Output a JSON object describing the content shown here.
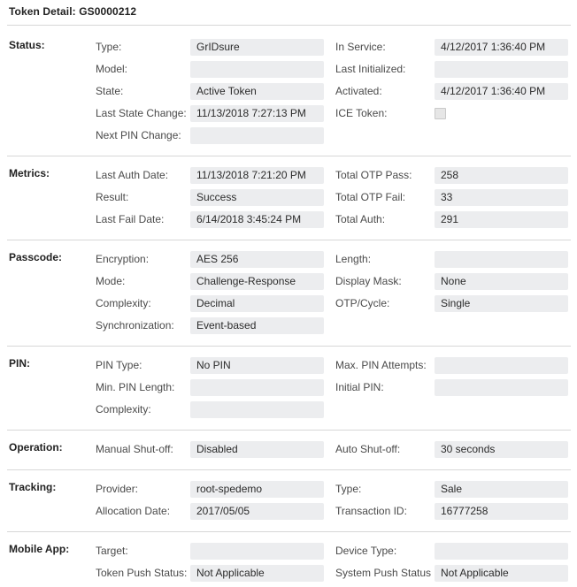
{
  "header": {
    "title": "Token Detail: GS0000212"
  },
  "colors": {
    "value_field_bg": "#ecedef",
    "divider": "#d7d7d7",
    "label_text": "#4a4a4a",
    "section_text": "#222222"
  },
  "sections": [
    {
      "name": "status",
      "label": "Status:",
      "rows": [
        {
          "left": {
            "label": "Type:",
            "value": "GrIDsure"
          },
          "right": {
            "label": "In Service:",
            "value": "4/12/2017 1:36:40 PM"
          }
        },
        {
          "left": {
            "label": "Model:",
            "value": ""
          },
          "right": {
            "label": "Last Initialized:",
            "value": ""
          }
        },
        {
          "left": {
            "label": "State:",
            "value": "Active Token"
          },
          "right": {
            "label": "Activated:",
            "value": "4/12/2017 1:36:40 PM"
          }
        },
        {
          "left": {
            "label": "Last State Change:",
            "value": "11/13/2018 7:27:13 PM"
          },
          "right": {
            "label": "ICE Token:",
            "value": "",
            "type": "checkbox",
            "checked": false
          }
        },
        {
          "left": {
            "label": "Next PIN Change:",
            "value": ""
          },
          "right": null
        }
      ]
    },
    {
      "name": "metrics",
      "label": "Metrics:",
      "rows": [
        {
          "left": {
            "label": "Last Auth Date:",
            "value": "11/13/2018 7:21:20 PM"
          },
          "right": {
            "label": "Total OTP Pass:",
            "value": "258"
          }
        },
        {
          "left": {
            "label": "Result:",
            "value": "Success"
          },
          "right": {
            "label": "Total OTP Fail:",
            "value": "33"
          }
        },
        {
          "left": {
            "label": "Last Fail Date:",
            "value": "6/14/2018 3:45:24 PM"
          },
          "right": {
            "label": "Total Auth:",
            "value": "291"
          }
        }
      ]
    },
    {
      "name": "passcode",
      "label": "Passcode:",
      "rows": [
        {
          "left": {
            "label": "Encryption:",
            "value": "AES 256"
          },
          "right": {
            "label": "Length:",
            "value": ""
          }
        },
        {
          "left": {
            "label": "Mode:",
            "value": "Challenge-Response"
          },
          "right": {
            "label": "Display Mask:",
            "value": "None"
          }
        },
        {
          "left": {
            "label": "Complexity:",
            "value": "Decimal"
          },
          "right": {
            "label": "OTP/Cycle:",
            "value": "Single"
          }
        },
        {
          "left": {
            "label": "Synchronization:",
            "value": "Event-based"
          },
          "right": null
        }
      ]
    },
    {
      "name": "pin",
      "label": "PIN:",
      "rows": [
        {
          "left": {
            "label": "PIN Type:",
            "value": "No PIN"
          },
          "right": {
            "label": "Max. PIN Attempts:",
            "value": ""
          }
        },
        {
          "left": {
            "label": "Min. PIN Length:",
            "value": ""
          },
          "right": {
            "label": "Initial PIN:",
            "value": ""
          }
        },
        {
          "left": {
            "label": "Complexity:",
            "value": ""
          },
          "right": null
        }
      ]
    },
    {
      "name": "operation",
      "label": "Operation:",
      "rows": [
        {
          "left": {
            "label": "Manual Shut-off:",
            "value": "Disabled"
          },
          "right": {
            "label": "Auto Shut-off:",
            "value": "30 seconds"
          }
        }
      ]
    },
    {
      "name": "tracking",
      "label": "Tracking:",
      "rows": [
        {
          "left": {
            "label": "Provider:",
            "value": "root-spedemo"
          },
          "right": {
            "label": "Type:",
            "value": "Sale"
          }
        },
        {
          "left": {
            "label": "Allocation Date:",
            "value": "2017/05/05"
          },
          "right": {
            "label": "Transaction ID:",
            "value": "16777258"
          }
        }
      ]
    },
    {
      "name": "mobile-app",
      "label": "Mobile App:",
      "rows": [
        {
          "left": {
            "label": "Target:",
            "value": ""
          },
          "right": {
            "label": "Device Type:",
            "value": ""
          }
        },
        {
          "left": {
            "label": "Token Push Status:",
            "value": "Not Applicable"
          },
          "right": {
            "label": "System Push Status",
            "value": "Not Applicable"
          }
        }
      ]
    }
  ]
}
